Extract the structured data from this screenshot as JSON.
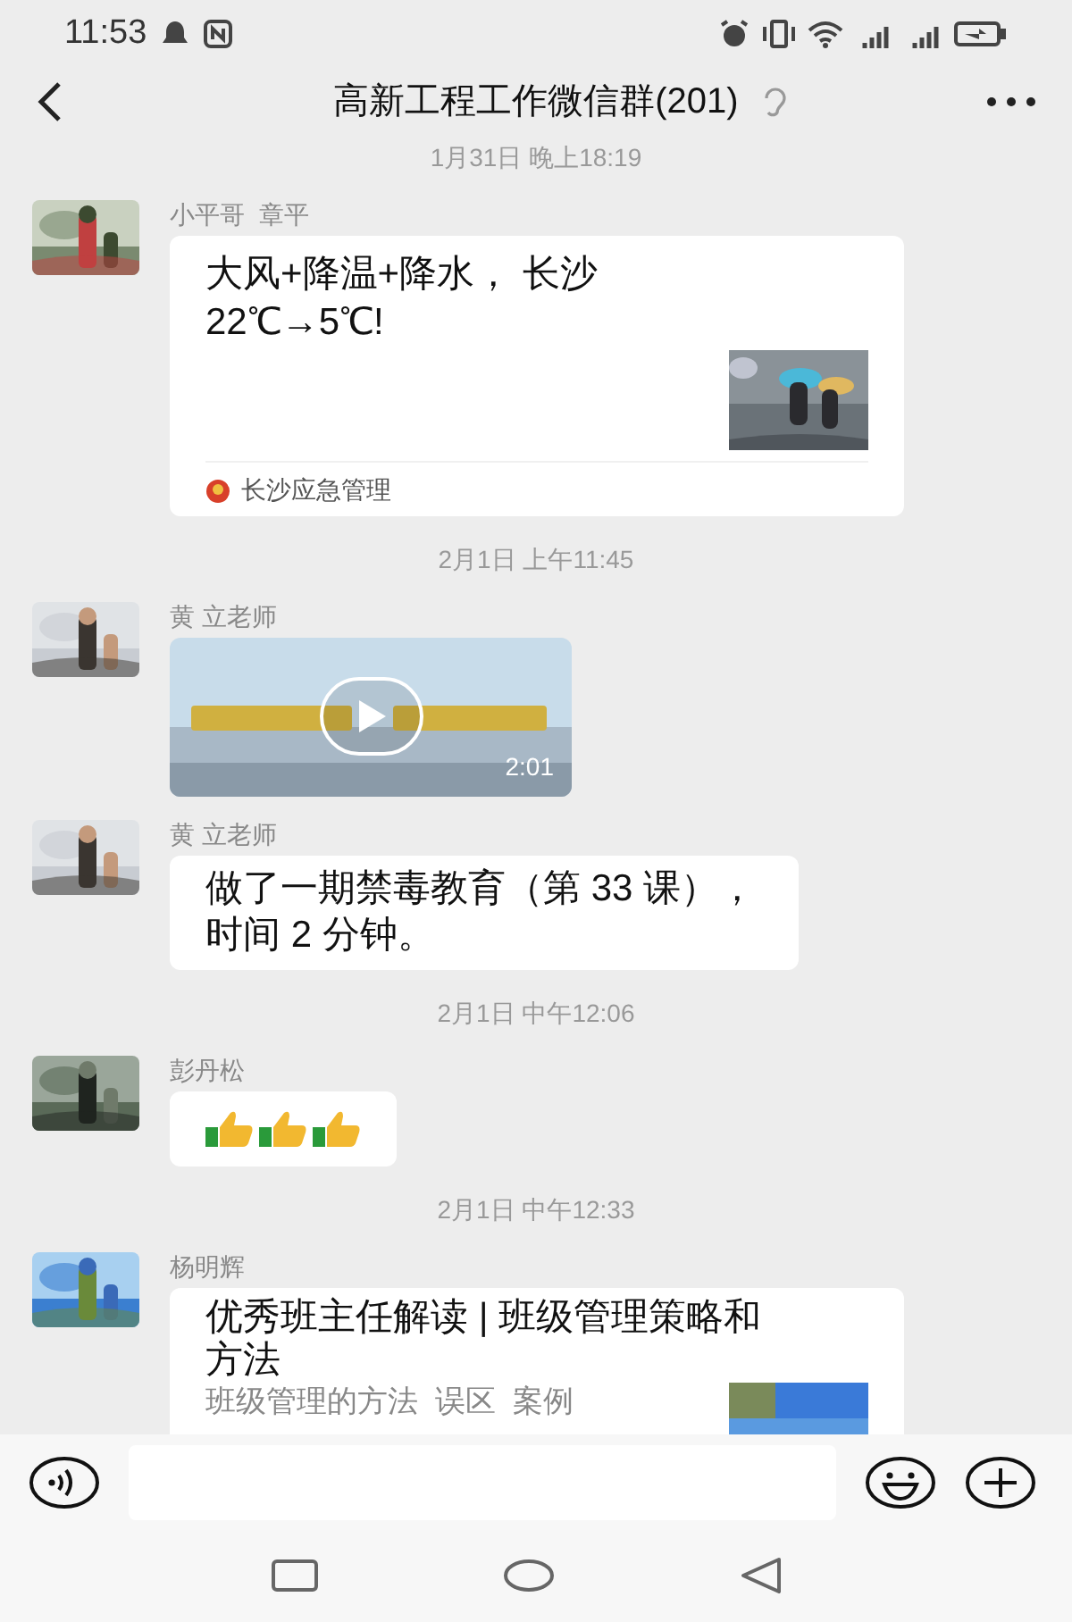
{
  "status_bar": {
    "time": "11:53"
  },
  "header": {
    "title": "高新工程工作微信群(201)"
  },
  "messages": [
    {
      "kind": "timestamp",
      "text": "1月31日 晚上18:19"
    },
    {
      "kind": "link_card",
      "sender": "小平哥  章平",
      "title": "大风+降温+降水， 长沙22℃→5℃!",
      "source": "长沙应急管理"
    },
    {
      "kind": "timestamp",
      "text": "2月1日 上午11:45"
    },
    {
      "kind": "video",
      "sender": "黄 立老师",
      "duration": "2:01"
    },
    {
      "kind": "text",
      "sender": "黄 立老师",
      "text": "做了一期禁毒教育（第 33 课），时间 2 分钟。"
    },
    {
      "kind": "timestamp",
      "text": "2月1日 中午12:06"
    },
    {
      "kind": "stickers",
      "sender": "彭丹松",
      "items": [
        {
          "kind": "thumbs_up"
        },
        {
          "kind": "thumbs_up"
        },
        {
          "kind": "thumbs_up"
        }
      ]
    },
    {
      "kind": "timestamp",
      "text": "2月1日 中午12:33"
    },
    {
      "kind": "article",
      "sender": "杨明辉",
      "title": "优秀班主任解读 | 班级管理策略和方法",
      "summary": "班级管理的方法  误区  案例"
    }
  ]
}
